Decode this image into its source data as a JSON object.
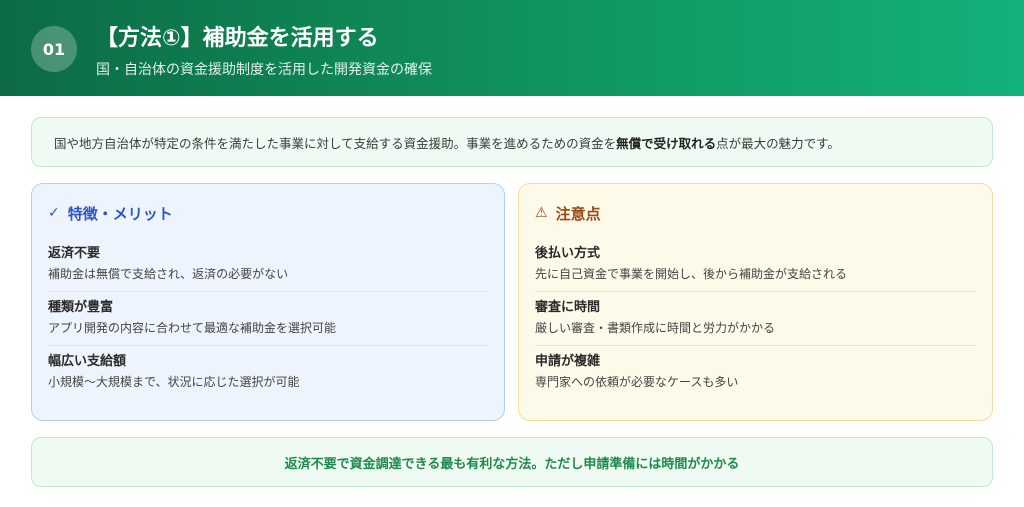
{
  "header": {
    "number": "01",
    "title": "【方法①】補助金を活用する",
    "subtitle": "国・自治体の資金援助制度を活用した開発資金の確保"
  },
  "intro": {
    "text_before": "国や地方自治体が特定の条件を満たした事業に対して支給する資金援助。事業を進めるための資金を",
    "text_bold": "無償で受け取れる",
    "text_after": "点が最大の魅力です。"
  },
  "merits": {
    "icon": "check-icon",
    "icon_glyph": "✓",
    "heading": "特徴・メリット",
    "items": [
      {
        "title": "返済不要",
        "desc": "補助金は無償で支給され、返済の必要がない"
      },
      {
        "title": "種類が豊富",
        "desc": "アプリ開発の内容に合わせて最適な補助金を選択可能"
      },
      {
        "title": "幅広い支給額",
        "desc": "小規模〜大規模まで、状況に応じた選択が可能"
      }
    ]
  },
  "cautions": {
    "icon": "warning-icon",
    "icon_glyph": "⚠",
    "heading": "注意点",
    "items": [
      {
        "title": "後払い方式",
        "desc": "先に自己資金で事業を開始し、後から補助金が支給される"
      },
      {
        "title": "審査に時間",
        "desc": "厳しい審査・書類作成に時間と労力がかかる"
      },
      {
        "title": "申請が複雑",
        "desc": "専門家への依頼が必要なケースも多い"
      }
    ]
  },
  "summary": {
    "text": "返済不要で資金調達できる最も有利な方法。ただし申請準備には時間がかかる"
  },
  "colors": {
    "header_start": "#0c6b45",
    "header_end": "#12b27a",
    "merit_accent": "#2f56c9",
    "caution_accent": "#9a4a12",
    "summary_text": "#1f8a4c"
  }
}
